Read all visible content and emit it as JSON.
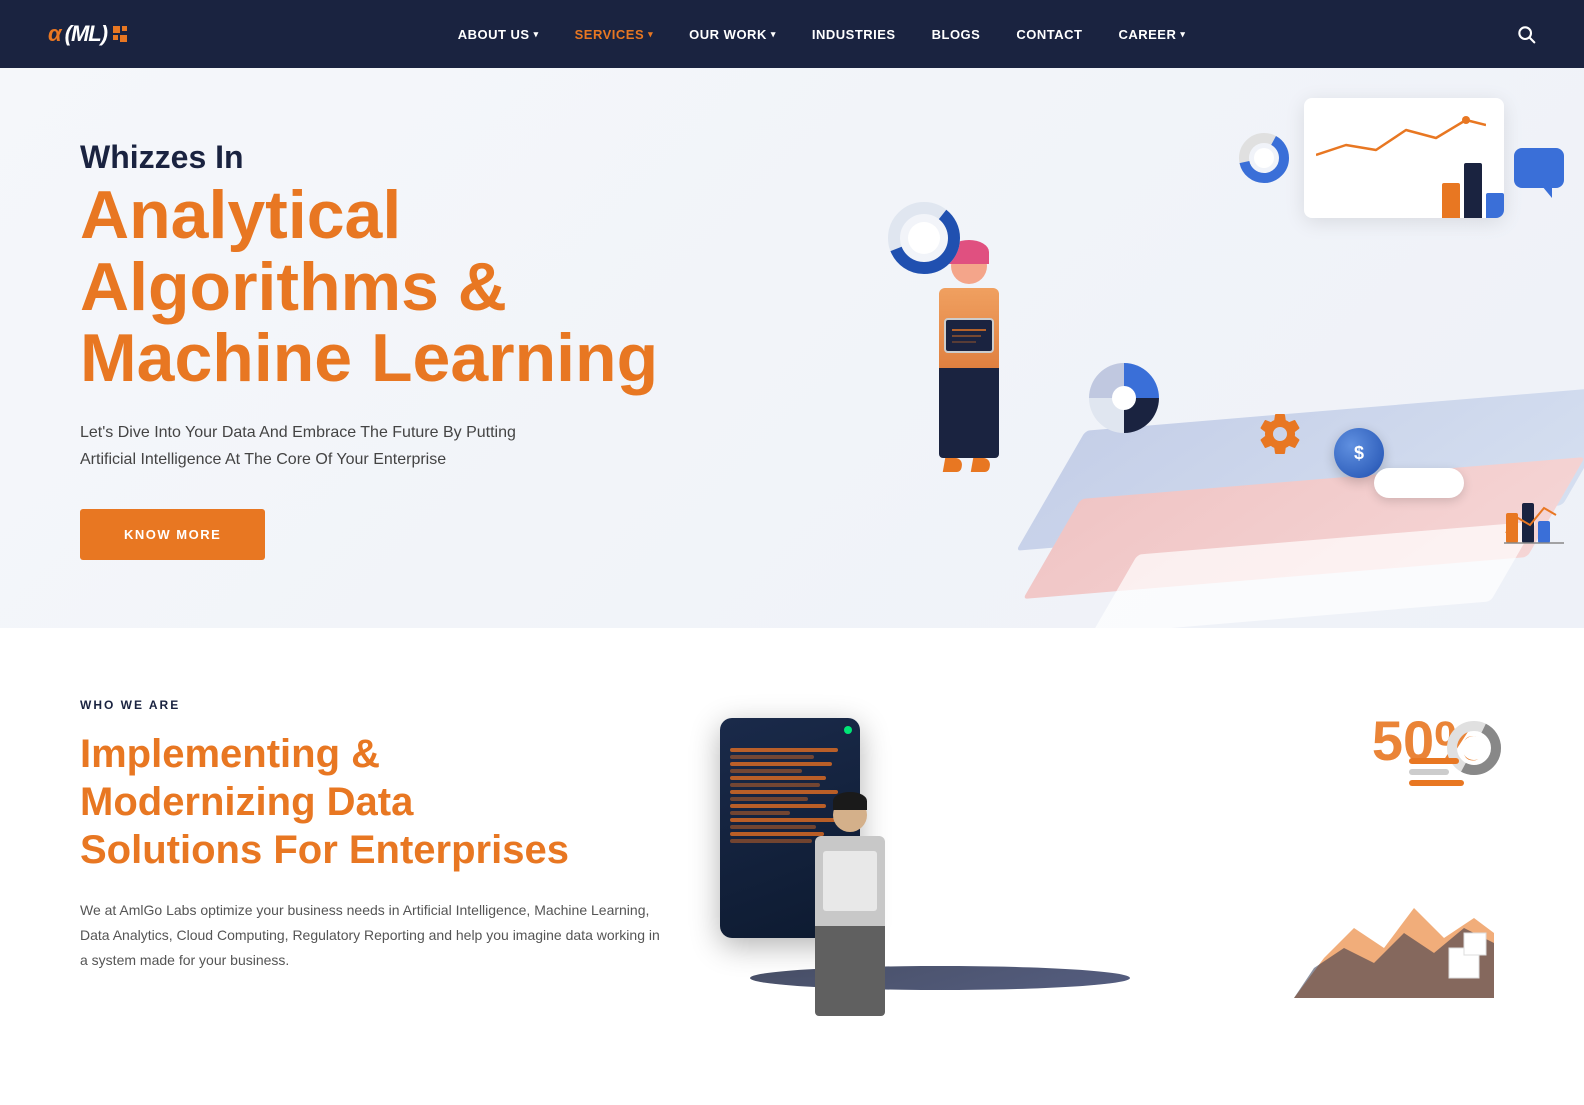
{
  "brand": {
    "name_alpha": "α",
    "name_ml": "(ML)",
    "logo_alt": "AmlGo ML Logo"
  },
  "nav": {
    "links": [
      {
        "label": "ABOUT US",
        "has_dropdown": true,
        "active": false
      },
      {
        "label": "SERVICES",
        "has_dropdown": true,
        "active": true
      },
      {
        "label": "OUR WORK",
        "has_dropdown": true,
        "active": false
      },
      {
        "label": "INDUSTRIES",
        "has_dropdown": false,
        "active": false
      },
      {
        "label": "BLOGS",
        "has_dropdown": false,
        "active": false
      },
      {
        "label": "CONTACT",
        "has_dropdown": false,
        "active": false
      },
      {
        "label": "CAREER",
        "has_dropdown": true,
        "active": false
      }
    ]
  },
  "hero": {
    "subtitle": "Whizzes In",
    "title_line1": "Analytical",
    "title_line2": "Algorithms &",
    "title_line3": "Machine Learning",
    "description_line1": "Let's Dive Into Your Data And Embrace The Future By Putting",
    "description_line2": "Artificial Intelligence At The Core Of Your Enterprise",
    "cta_button": "KNOW MORE"
  },
  "who_we_are": {
    "section_label": "WHO WE ARE",
    "title_line1": "Implementing &",
    "title_line2": "Modernizing Data",
    "title_line3": "Solutions For Enterprises",
    "description": "We at AmlGo Labs optimize your business needs in Artificial Intelligence, Machine Learning, Data Analytics, Cloud Computing, Regulatory Reporting and help you imagine data working in a system made for your business.",
    "stats_pct": "50%"
  },
  "colors": {
    "primary_orange": "#e87722",
    "nav_bg": "#1a2340",
    "text_dark": "#1a2340",
    "text_orange": "#e87722"
  }
}
